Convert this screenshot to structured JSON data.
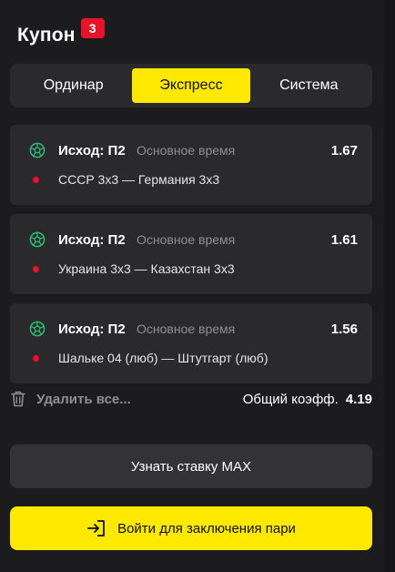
{
  "coupon": {
    "title": "Купон",
    "count": "3"
  },
  "tabs": [
    {
      "label": "Ординар",
      "active": false
    },
    {
      "label": "Экспресс",
      "active": true
    },
    {
      "label": "Система",
      "active": false
    }
  ],
  "bets": [
    {
      "outcome": "Исход: П2",
      "period": "Основное время",
      "odds": "1.67",
      "match": "СССР 3х3 — Германия 3х3",
      "sport_icon": "football-icon"
    },
    {
      "outcome": "Исход: П2",
      "period": "Основное время",
      "odds": "1.61",
      "match": "Украина 3х3 — Казахстан 3х3",
      "sport_icon": "football-icon"
    },
    {
      "outcome": "Исход: П2",
      "period": "Основное время",
      "odds": "1.56",
      "match": "Шальке 04 (люб) — Штутгарт (люб)",
      "sport_icon": "football-icon"
    }
  ],
  "delete_all": "Удалить все...",
  "total": {
    "label": "Общий коэфф.",
    "value": "4.19"
  },
  "max_button": "Узнать ставку MAX",
  "login_button": "Войти для заключения пари",
  "colors": {
    "accent": "#fde800",
    "badge": "#e8132a",
    "live_dot": "#e8132a",
    "sport_icon": "#2bb673"
  }
}
